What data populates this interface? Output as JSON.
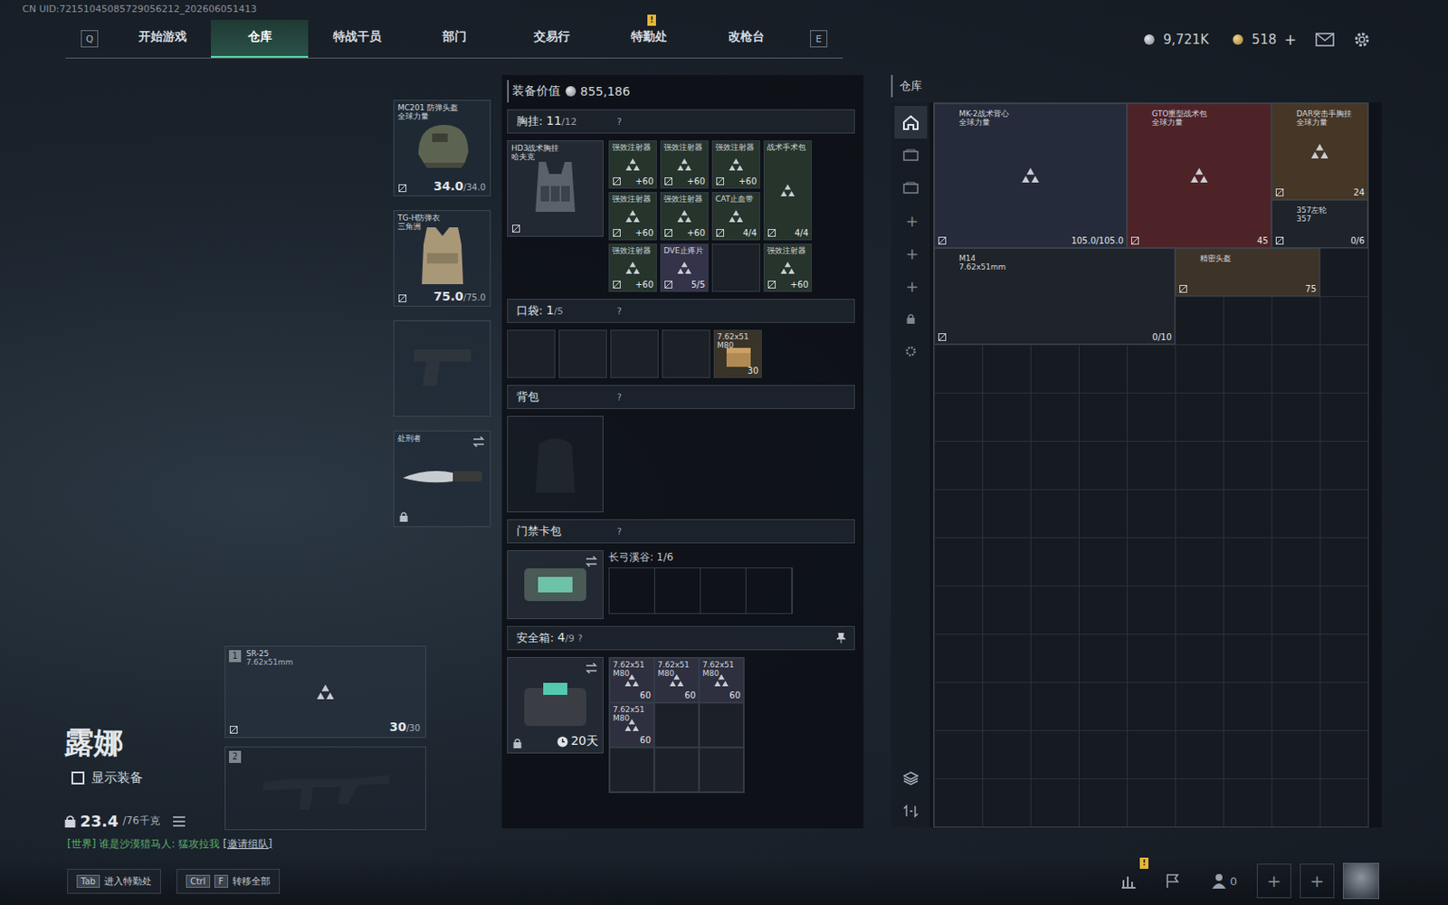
{
  "header": {
    "uid": "CN UID:72151045085729056212_202606051413",
    "key_left": "Q",
    "key_right": "E",
    "tabs": [
      {
        "label": "开始游戏",
        "selected": false,
        "badge": ""
      },
      {
        "label": "仓库",
        "selected": true,
        "badge": ""
      },
      {
        "label": "特战干员",
        "selected": false,
        "badge": ""
      },
      {
        "label": "部门",
        "selected": false,
        "badge": ""
      },
      {
        "label": "交易行",
        "selected": false,
        "badge": ""
      },
      {
        "label": "特勤处",
        "selected": false,
        "badge": "!"
      },
      {
        "label": "改枪台",
        "selected": false,
        "badge": ""
      }
    ],
    "currency": {
      "coins": "9,721K",
      "tokens": "518",
      "add": "+"
    }
  },
  "gear": [
    {
      "kind": "helmet",
      "name": "MC201 防弹头盔",
      "sub": "全球力量",
      "value": "34.0",
      "max": "/34.0",
      "locked": false
    },
    {
      "kind": "armor",
      "name": "TG-H防弹衣",
      "sub": "三角洲",
      "value": "75.0",
      "max": "/75.0",
      "locked": false
    },
    {
      "kind": "pistol",
      "name": "",
      "sub": "",
      "value": "",
      "max": "",
      "locked": false
    },
    {
      "kind": "melee",
      "name": "处刑者",
      "sub": "",
      "value": "",
      "max": "",
      "locked": true
    }
  ],
  "weapons": [
    {
      "index": "1",
      "name": "SR-25",
      "caliber": "7.62x51mm",
      "ammo": "30",
      "max": "/30",
      "empty": false
    },
    {
      "index": "2",
      "name": "",
      "caliber": "",
      "ammo": "",
      "max": "",
      "empty": true
    }
  ],
  "operator": {
    "name": "露娜",
    "show_gear": {
      "label": "显示装备",
      "checked": false
    },
    "weight": "23.4",
    "weight_max": "/76千克"
  },
  "chat": {
    "channel": "[世界]",
    "text": " 谁是沙漠猎马人: 猛攻拉我 ",
    "action": "[邀请组队]"
  },
  "loadout": {
    "value_label": "装备价值",
    "value": "855,186",
    "chest": {
      "title": "胸挂:",
      "count": "11",
      "capacity": "/12",
      "help": "?",
      "rig_name": "HD3战术胸挂",
      "rig_brand": "哈夫克",
      "items": [
        {
          "name": "强效注射器",
          "amount": "+60",
          "color": "#26342c"
        },
        {
          "name": "强效注射器",
          "amount": "+60",
          "color": "#26342c"
        },
        {
          "name": "强效注射器",
          "amount": "+60",
          "color": "#26342c"
        },
        {
          "name": "战术手术包",
          "amount": "4/4",
          "color": "#26342c"
        },
        {
          "name": "强效注射器",
          "amount": "+60",
          "color": "#26342c"
        },
        {
          "name": "强效注射器",
          "amount": "+60",
          "color": "#26342c"
        },
        {
          "name": "CAT止血带",
          "amount": "4/4",
          "color": "#26342c"
        },
        {
          "name": "强效注射器",
          "amount": "+60",
          "color": "#26342c"
        },
        {
          "name": "DVE止疼片",
          "amount": "5/5",
          "color": "#35334a"
        },
        {
          "name": "强效注射器",
          "amount": "+60",
          "color": "#26342c"
        }
      ]
    },
    "pockets": {
      "title": "口袋:",
      "count": "1",
      "capacity": "/5",
      "help": "?",
      "slots": [
        {
          "kind": "empty",
          "name": "",
          "amount": "",
          "color": "#1c2128"
        },
        {
          "kind": "empty",
          "name": "",
          "amount": "",
          "color": "#1c2128"
        },
        {
          "kind": "empty",
          "name": "",
          "amount": "",
          "color": "#1c2128"
        },
        {
          "kind": "empty",
          "name": "",
          "amount": "",
          "color": "#1c2128"
        },
        {
          "kind": "item",
          "name": "7.62x51 M80",
          "amount": "30",
          "color": "#3a3328"
        }
      ]
    },
    "backpack": {
      "title": "背包",
      "help": "?"
    },
    "keycards": {
      "title": "门禁卡包",
      "help": "?",
      "map": "长弓溪谷: 1/6"
    },
    "safe": {
      "title": "安全箱:",
      "count": "4",
      "capacity": "/9",
      "help": "?",
      "timer": "20天",
      "items": [
        {
          "name": "7.62x51 M80",
          "amount": "60",
          "color": "#2e3040"
        },
        {
          "name": "7.62x51 M80",
          "amount": "60",
          "color": "#2e3040"
        },
        {
          "name": "7.62x51 M80",
          "amount": "60",
          "color": "#2e3040"
        },
        {
          "name": "7.62x51 M80",
          "amount": "60",
          "color": "#2e3040"
        }
      ]
    }
  },
  "warehouse": {
    "title": "仓库",
    "tabs": [
      {
        "selected": true
      },
      {
        "selected": false
      },
      {
        "selected": false
      }
    ],
    "add_slots": [
      "+",
      "+",
      "+"
    ],
    "items": [
      {
        "name": "MK-2战术背心",
        "sub": "全球力量",
        "amount": "105.0/105.0",
        "color": "#252b3a",
        "placeholder": true
      },
      {
        "name": "GTO重型战术包",
        "sub": "全球力量",
        "amount": "45",
        "color": "#4e2328",
        "placeholder": true
      },
      {
        "name": "DAR突击手胸挂",
        "sub": "全球力量",
        "amount": "24",
        "color": "#463626",
        "placeholder": true
      },
      {
        "name": "357左轮",
        "sub": "357",
        "amount": "0/6",
        "color": "#1f242b",
        "placeholder": false
      },
      {
        "name": "M14",
        "sub": "7.62x51mm",
        "amount": "0/10",
        "color": "#1f242b",
        "placeholder": false
      },
      {
        "name": "精密头盔",
        "sub": "",
        "amount": "75",
        "color": "#3e3328",
        "placeholder": false
      }
    ]
  },
  "bottom": {
    "keys": [
      {
        "keys": [
          "Tab"
        ],
        "label": "进入特勤处"
      },
      {
        "keys": [
          "Ctrl",
          "F"
        ],
        "label": "转移全部"
      }
    ],
    "stats_badge": "!",
    "friends": "0",
    "add_buttons": [
      "+",
      "+"
    ]
  }
}
